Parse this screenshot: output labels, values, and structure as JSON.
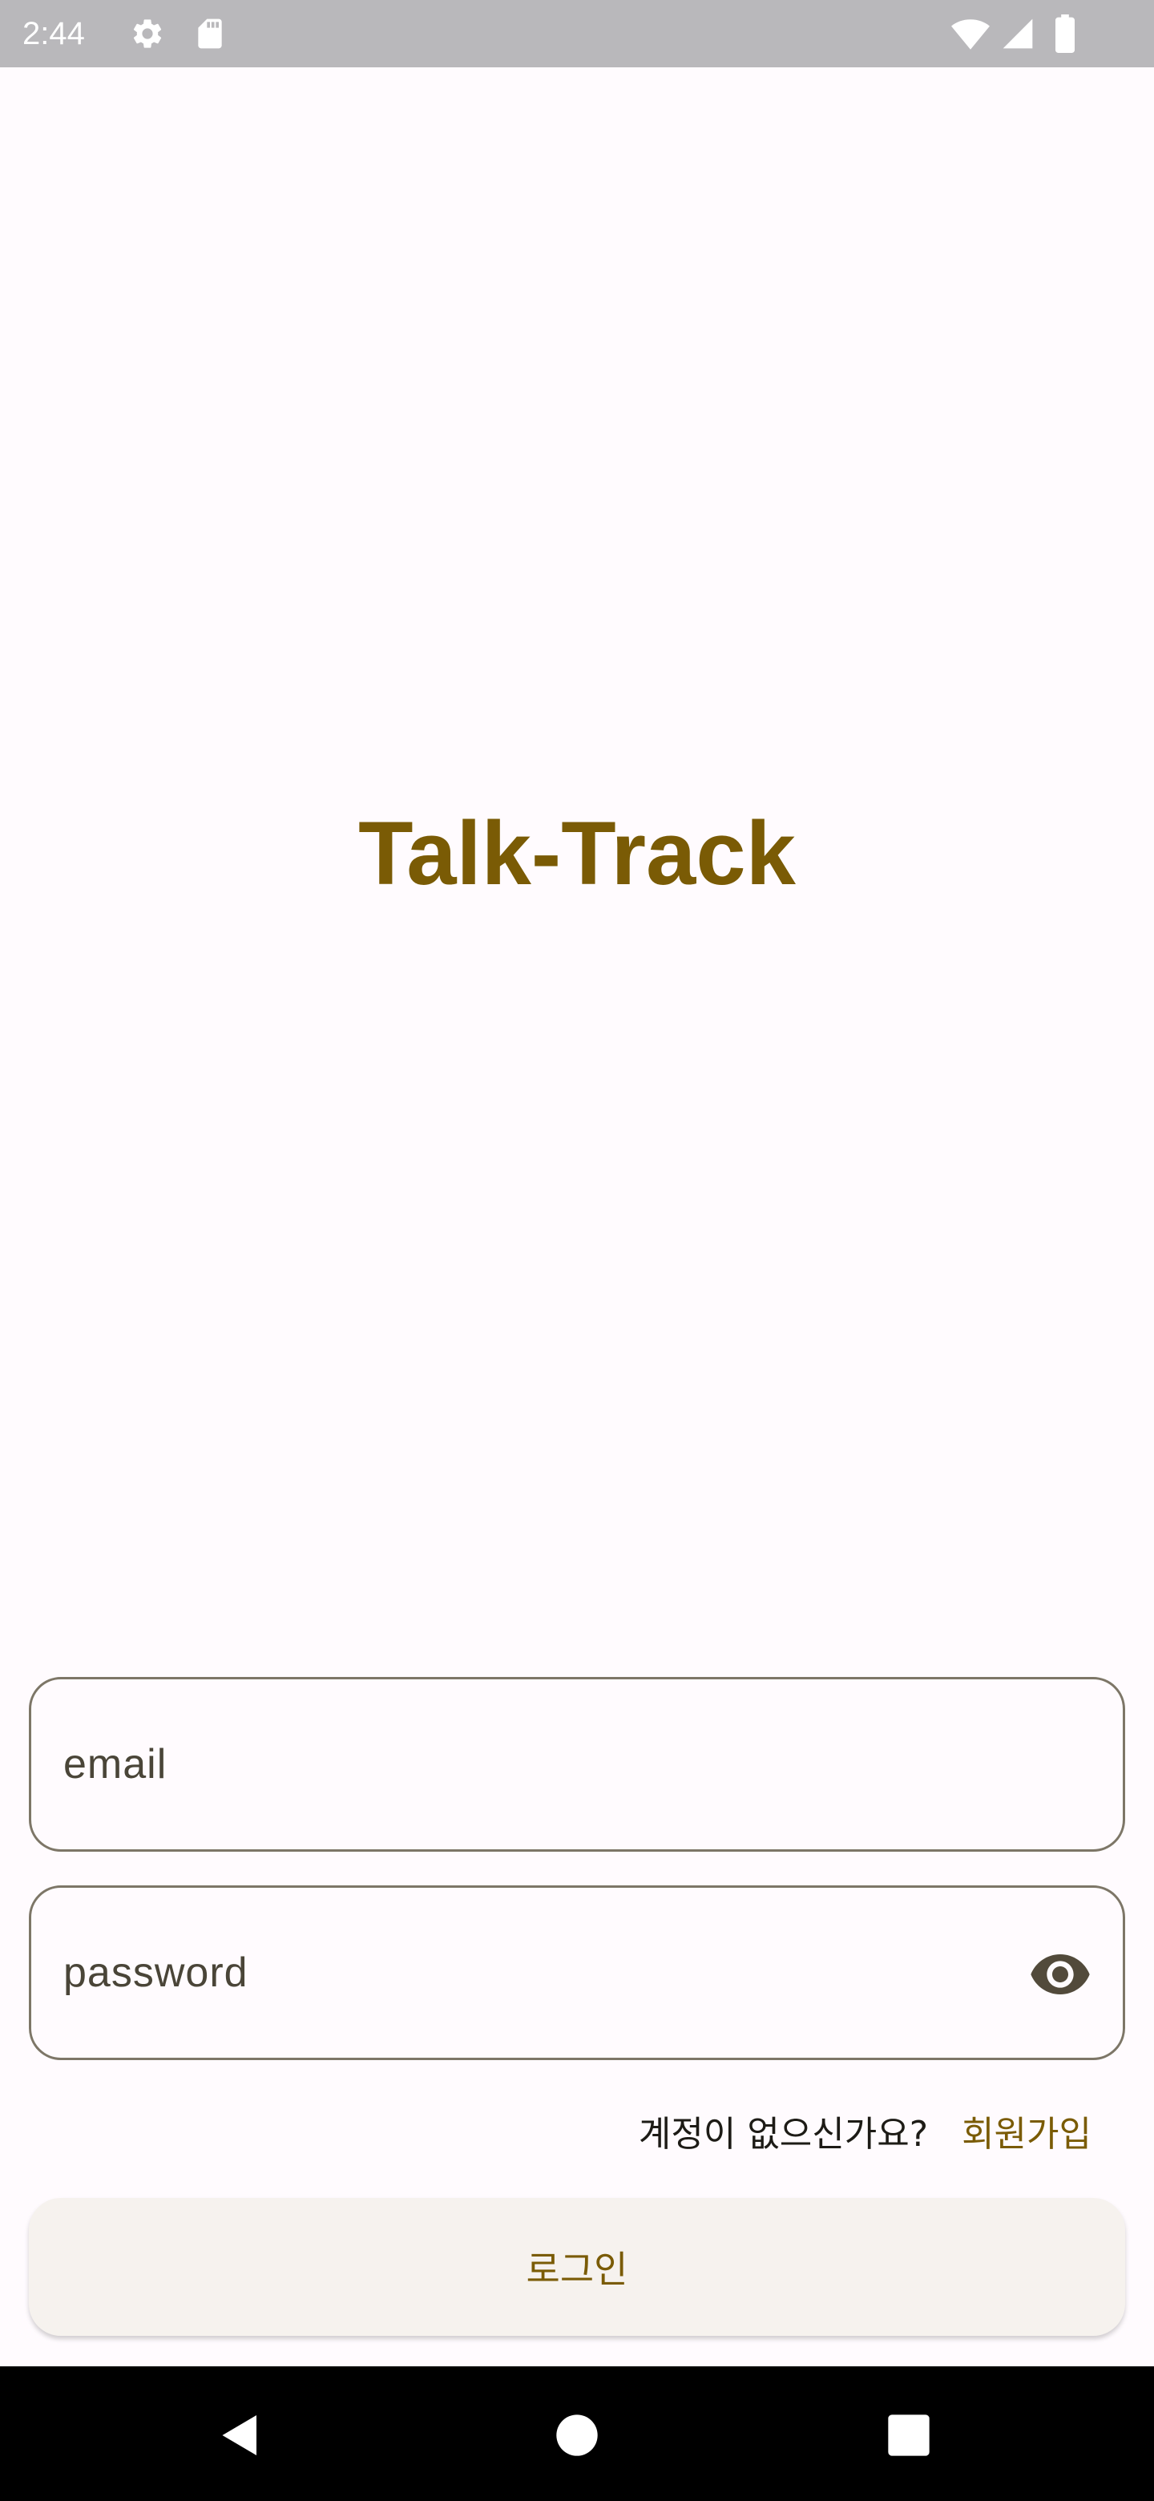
{
  "status_bar": {
    "time": "2:44",
    "icons": [
      "settings-icon",
      "sd-card-icon",
      "wifi-icon",
      "cellular-signal-icon",
      "battery-icon"
    ]
  },
  "app": {
    "title": "Talk-Track",
    "accent_color": "#7a5b05"
  },
  "form": {
    "email_placeholder": "email",
    "email_value": "",
    "password_placeholder": "password",
    "password_value": "",
    "password_toggle_icon": "eye-icon"
  },
  "signup": {
    "question": "계정이 없으신가요?",
    "link_label": "회원가입"
  },
  "login_button": {
    "label": "로그인"
  },
  "nav_bar": {
    "icons": [
      "back-icon",
      "home-icon",
      "recents-icon"
    ]
  }
}
